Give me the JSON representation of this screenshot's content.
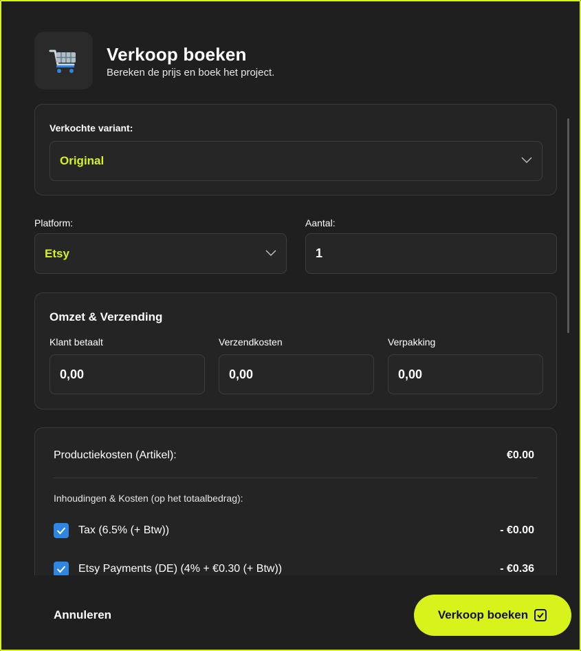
{
  "header": {
    "title": "Verkoop boeken",
    "subtitle": "Bereken de prijs en boek het project.",
    "icon": "shopping-cart-icon"
  },
  "variant": {
    "label": "Verkochte variant:",
    "selected": "Original"
  },
  "platform": {
    "label": "Platform:",
    "selected": "Etsy"
  },
  "quantity": {
    "label": "Aantal:",
    "value": "1"
  },
  "revenue": {
    "title": "Omzet & Verzending",
    "fields": [
      {
        "label": "Klant betaalt",
        "value": "0,00"
      },
      {
        "label": "Verzendkosten",
        "value": "0,00"
      },
      {
        "label": "Verpakking",
        "value": "0,00"
      }
    ]
  },
  "summary": {
    "production_label": "Productiekosten (Artikel):",
    "production_value": "€0.00",
    "deductions_heading": "Inhoudingen & Kosten (op het totaalbedrag):",
    "deductions": [
      {
        "label": "Tax (6.5% (+ Btw))",
        "value": "- €0.00",
        "checked": true
      },
      {
        "label": "Etsy Payments (DE) (4% + €0.30 (+ Btw))",
        "value": "- €0.36",
        "checked": true
      }
    ]
  },
  "footer": {
    "cancel_label": "Annuleren",
    "submit_label": "Verkoop boeken",
    "submit_icon": "checkbox-icon"
  },
  "colors": {
    "accent": "#d8f31b",
    "background": "#1f1f1f",
    "checkbox": "#2f86e0"
  }
}
